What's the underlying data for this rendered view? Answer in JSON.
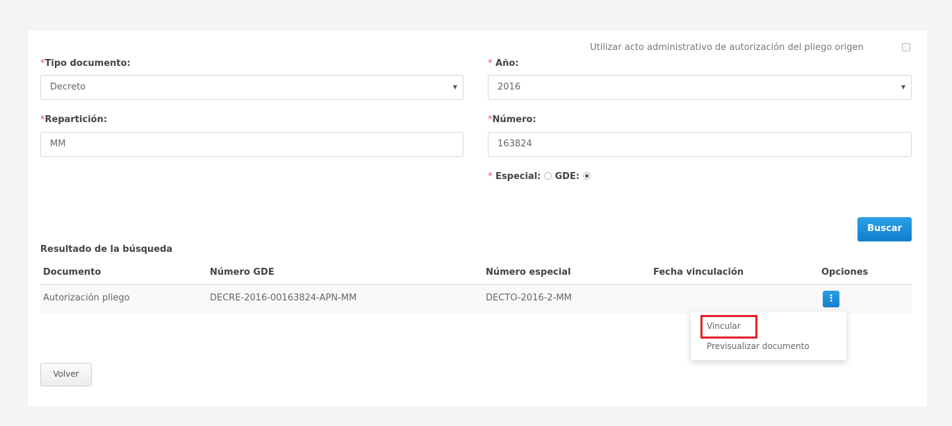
{
  "use_origin_act": {
    "label": "Utilizar acto administrativo de autorización del pliego origen",
    "checked": false
  },
  "tipo_documento": {
    "required_mark": "*",
    "label": "Tipo documento:",
    "value": "Decreto"
  },
  "anio": {
    "required_mark": "*",
    "label": "Año:",
    "value": "2016"
  },
  "reparticion": {
    "required_mark": "*",
    "label": "Repartición:",
    "value": "MM"
  },
  "numero": {
    "required_mark": "*",
    "label": "Número:",
    "value": "163824"
  },
  "tipo_numero": {
    "required_mark": "*",
    "especial_label": "Especial:",
    "gde_label": "GDE:",
    "selected": "GDE"
  },
  "buscar_label": "Buscar",
  "results": {
    "title": "Resultado de la búsqueda",
    "columns": [
      "Documento",
      "Número GDE",
      "Número especial",
      "Fecha vinculación",
      "Opciones"
    ],
    "rows": [
      {
        "documento": "Autorización pliego",
        "numero_gde": "DECRE-2016-00163824-APN-MM",
        "numero_especial": "DECTO-2016-2-MM",
        "fecha_vinculacion": "",
        "options_icon": "⋮"
      }
    ]
  },
  "options_menu": {
    "items": [
      "Vincular",
      "Previsualizar documento"
    ],
    "highlighted": "Vincular"
  },
  "volver_label": "Volver",
  "colors": {
    "primary": "#1a8ad6",
    "required": "#e05555",
    "highlight": "#e3202b"
  }
}
